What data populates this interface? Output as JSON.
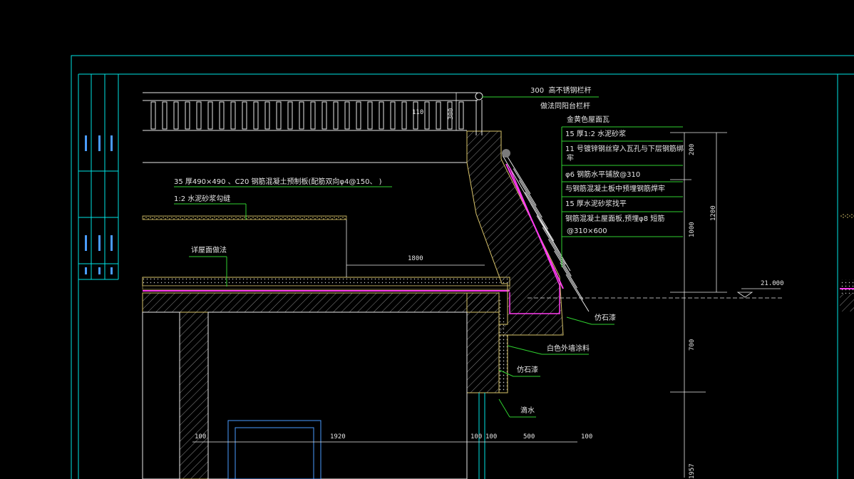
{
  "notes": {
    "railing_height": "300",
    "railing_title": "高不锈钢栏杆",
    "railing_ref": "做法同阳台栏杆",
    "tile_color": "金黄色屋面瓦",
    "layer1": "15  厚1:2  水泥砂浆",
    "layer2": "11  号镀锌钢丝穿入瓦孔与下层钢筋绑",
    "layer2b": "牢",
    "layer3": "φ6  钢筋水平铺放@310",
    "layer4": "与钢筋混凝土板中预埋钢筋焊牢",
    "layer5": "15  厚水泥砂浆找平",
    "layer6": "钢筋混凝土屋面板,预埋φ8  短筋",
    "layer6b": "@310×600",
    "slab_note": "35  厚490×490    、C20  钢筋混凝土预制板(配筋双向φ4@150、  )",
    "mortar_note": "1:2  水泥砂浆勾缝",
    "roof_ref": "详屋面做法",
    "stone_paint_1": "仿石漆",
    "white_paint": "白色外墙涂料",
    "stone_paint_2": "仿石漆",
    "drip": "滴水"
  },
  "dims": {
    "d110": "110",
    "d300v": "300",
    "d200": "200",
    "d1000": "1000",
    "d1200": "1200",
    "d1800": "1800",
    "d700": "700",
    "d1957": "1957",
    "elev": "21.000",
    "b100a": "100",
    "b1920": "1920",
    "b100b": "100",
    "b100c": "100",
    "b500": "500",
    "b100d": "100"
  },
  "colors": {
    "frame": "#00e5e5",
    "leader": "#2fd12f",
    "concrete": "#d8c36a",
    "membrane": "#ff3cf0",
    "hatch": "#b0b0b0",
    "wall_white": "#e8e8e8"
  }
}
